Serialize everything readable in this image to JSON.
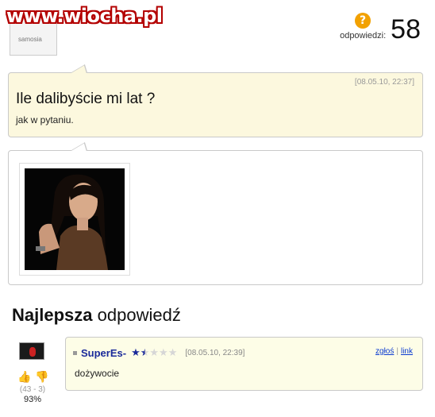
{
  "watermark": "www.wiocha.pl",
  "asker": {
    "avatar_caption": "samosia"
  },
  "answers": {
    "label": "odpowiedzi:",
    "count": "58",
    "icon": "question-mark-icon"
  },
  "question": {
    "date": "[08.05.10, 22:37]",
    "title": "Ile dalibyście mi lat ?",
    "description": "jak w pytaniu."
  },
  "best_answer": {
    "heading_bold": "Najlepsza",
    "heading_rest": "odpowiedź",
    "user": "SuperEs-",
    "rating_stars": 1.5,
    "rating_max": 5,
    "date": "[08.05.10, 22:39]",
    "report_link": "zgłoś",
    "link_label": "link",
    "text": "dożywocie",
    "votes": {
      "counts": "(43 - 3)",
      "percent": "93%"
    }
  },
  "colors": {
    "accent_blue": "#1a2a9a",
    "question_bg": "#fcf8de",
    "link": "#0b3bd1"
  }
}
